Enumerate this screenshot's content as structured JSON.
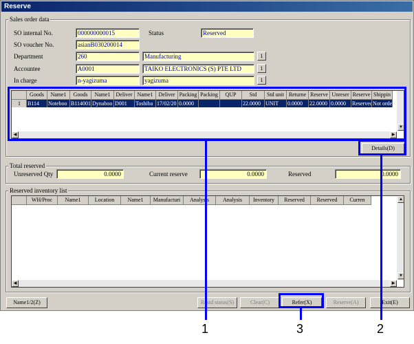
{
  "window": {
    "title": "Reserve"
  },
  "sales_order": {
    "group_label": "Sales order data",
    "so_internal_label": "SO internal No.",
    "so_internal_value": "000000000015",
    "status_label": "Status",
    "status_value": "Reserved",
    "so_voucher_label": "SO voucher No.",
    "so_voucher_value": "asianB030200014",
    "department_label": "Department",
    "department_code": "260",
    "department_name": "Manufacturing",
    "accountee_label": "Accountee",
    "accountee_code": "A0001",
    "accountee_name": "TAIKO ELECTRONICS (S) PTE LTD",
    "incharge_label": "In charge",
    "incharge_code": "n-yagizuma",
    "incharge_name": "yagizuma",
    "lookup_label": "1"
  },
  "order_grid": {
    "headers": [
      "",
      "Goods",
      "Name1",
      "Goods",
      "Name1",
      "Deliver",
      "Name1",
      "Deliver",
      "Packing",
      "Packing",
      "QUP",
      "Std",
      "Std unit",
      "Returne",
      "Reserve",
      "Unreser",
      "Reserve",
      "Shippin"
    ],
    "row": [
      "1",
      "B114",
      "Noteboo",
      "B114001",
      "Dynaboo",
      "D001",
      "Toshiba",
      "17/02/20",
      "0.0000",
      "",
      "",
      "22.0000",
      "UNIT",
      "0.0000",
      "22.0000",
      "0.0000",
      "Reservec",
      "Not orde"
    ]
  },
  "details_button": "Details(D)",
  "total_reserved": {
    "group_label": "Total reserved",
    "unreserved_label": "Unreserved Qty",
    "unreserved_value": "0.0000",
    "current_label": "Current reserve",
    "current_value": "0.0000",
    "reserved_label": "Reserved",
    "reserved_value": "0.0000"
  },
  "inventory_grid": {
    "group_label": "Reserved inventory list",
    "headers": [
      "",
      "WH/Proc",
      "Name1",
      "Location",
      "Name1",
      "Manufacturi",
      "Analysis",
      "Analysis",
      "Inventory",
      "Reserved",
      "Reserved",
      "Curren"
    ]
  },
  "buttons": {
    "name12": "Name1/2(Z)",
    "restore": "Restd status(S)",
    "clear": "Clear(C)",
    "refer": "Refer(X)",
    "reserve": "Reserve(A)",
    "exit": "Exit(E)"
  },
  "callouts": {
    "c1": "1",
    "c2": "2",
    "c3": "3"
  },
  "colors": {
    "callout": "#0000ff",
    "field_bg": "#ffffc0",
    "title_bar": "#0a246a"
  }
}
